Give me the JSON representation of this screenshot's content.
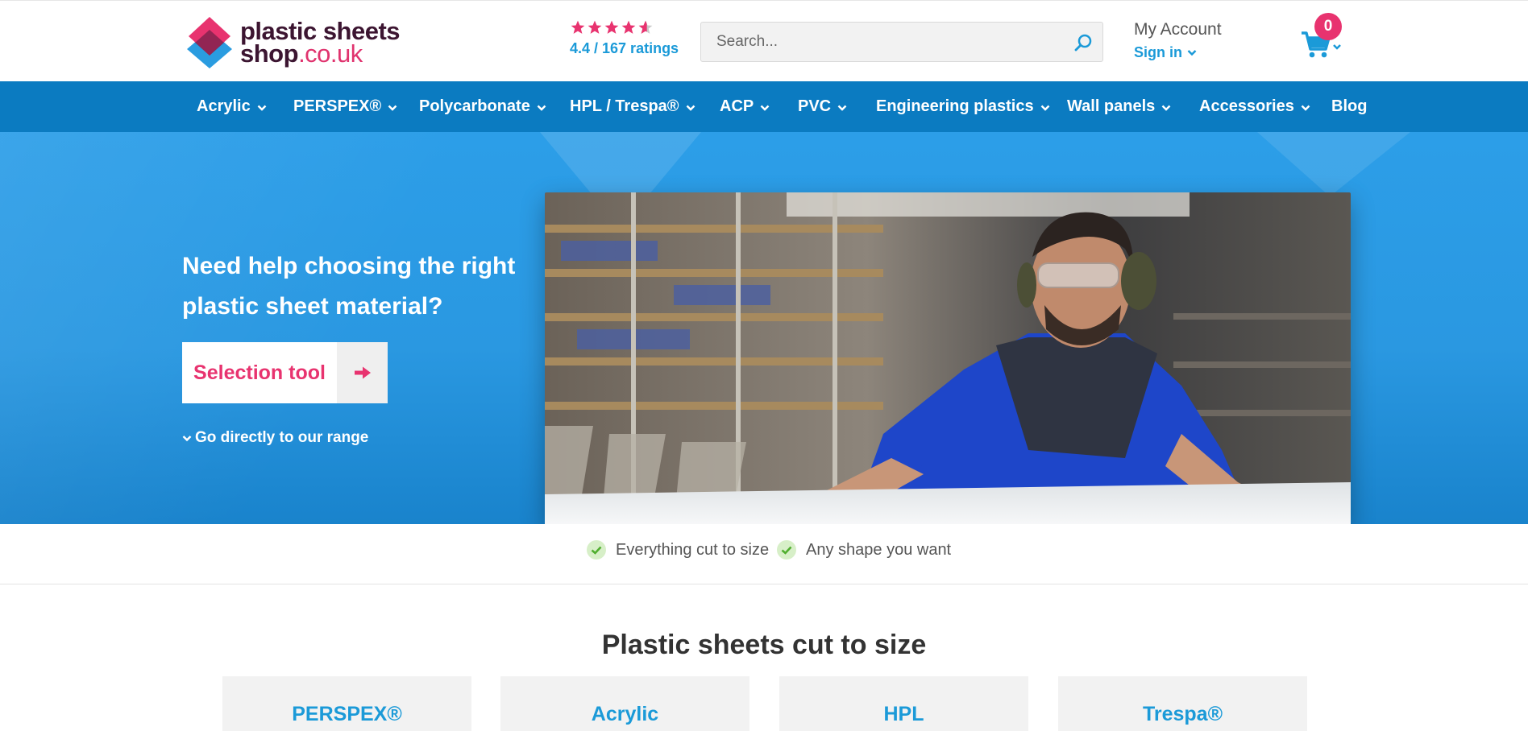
{
  "header": {
    "logo": {
      "line1": "plastic sheets",
      "line2_main": "shop",
      "line2_suffix": ".co.uk"
    },
    "rating": {
      "stars": 4.4,
      "text": "4.4 / 167 ratings"
    },
    "search": {
      "placeholder": "Search..."
    },
    "account": {
      "title": "My Account",
      "signin": "Sign in"
    },
    "cart": {
      "count": "0"
    }
  },
  "nav": {
    "items": [
      {
        "label": "Acrylic",
        "dropdown": true
      },
      {
        "label": "PERSPEX®",
        "dropdown": true
      },
      {
        "label": "Polycarbonate",
        "dropdown": true
      },
      {
        "label": "HPL / Trespa®",
        "dropdown": true
      },
      {
        "label": "ACP",
        "dropdown": true
      },
      {
        "label": "PVC",
        "dropdown": true
      },
      {
        "label": "Engineering plastics",
        "dropdown": true
      },
      {
        "label": "Wall panels",
        "dropdown": true
      },
      {
        "label": "Accessories",
        "dropdown": true
      },
      {
        "label": "Blog",
        "dropdown": false
      }
    ]
  },
  "hero": {
    "title": "Need help choosing the right plastic sheet material?",
    "cta_label": "Selection tool",
    "range_link": "Go directly to our range",
    "photo_icon": "warehouse-worker-photo"
  },
  "usp": {
    "items": [
      "Everything cut to size",
      "Any shape you want"
    ]
  },
  "section": {
    "title": "Plastic sheets cut to size",
    "cards": [
      "PERSPEX®",
      "Acrylic",
      "HPL",
      "Trespa®"
    ]
  },
  "colors": {
    "brand_pink": "#e8336f",
    "brand_blue": "#1b9ad8",
    "nav_blue": "#0b7bc1",
    "hero_blue": "#2c9ee8",
    "logo_dark": "#3c1531"
  }
}
